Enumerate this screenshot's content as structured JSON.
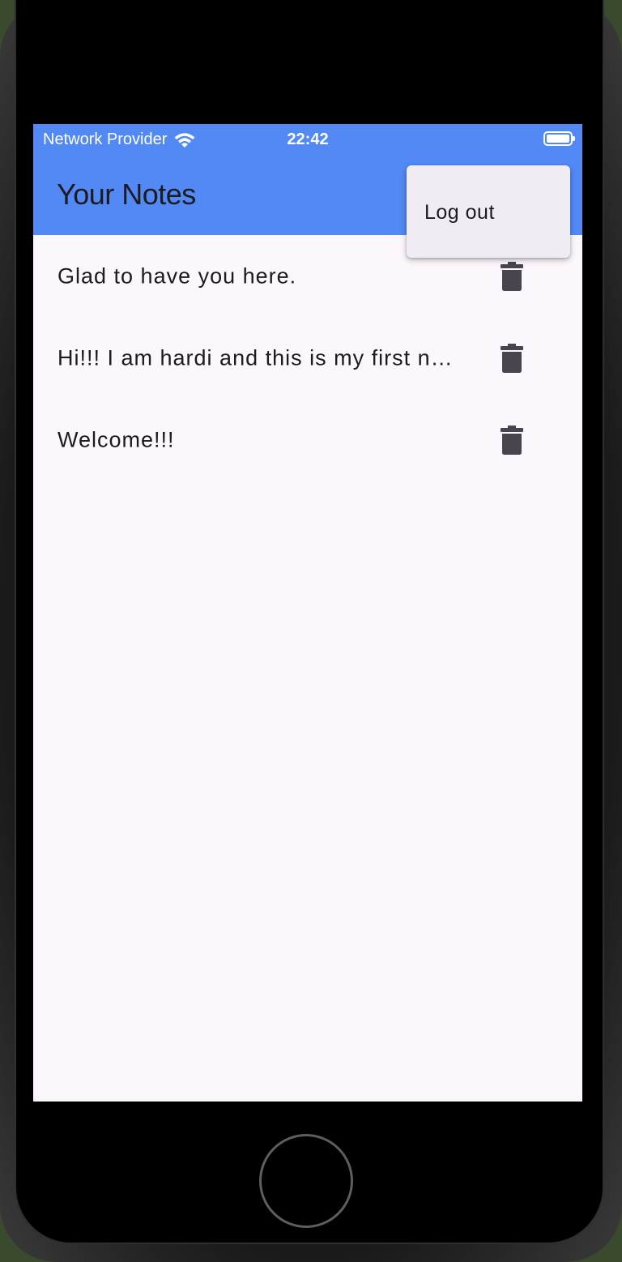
{
  "status_bar": {
    "carrier": "Network Provider",
    "time": "22:42"
  },
  "app_bar": {
    "title": "Your Notes"
  },
  "notes": [
    {
      "text": "Glad to have you here."
    },
    {
      "text": "Hi!!! I am hardi and this is my first note"
    },
    {
      "text": "Welcome!!!"
    }
  ],
  "popup_menu": {
    "items": [
      {
        "label": "Log out"
      }
    ]
  },
  "colors": {
    "app_bar": "#5289f4",
    "background": "#fcf7fd",
    "menu_background": "#f1ecf4",
    "icon": "#49454f"
  },
  "icons": {
    "status": [
      "wifi-icon",
      "battery-icon"
    ],
    "note_action": "delete-icon"
  }
}
